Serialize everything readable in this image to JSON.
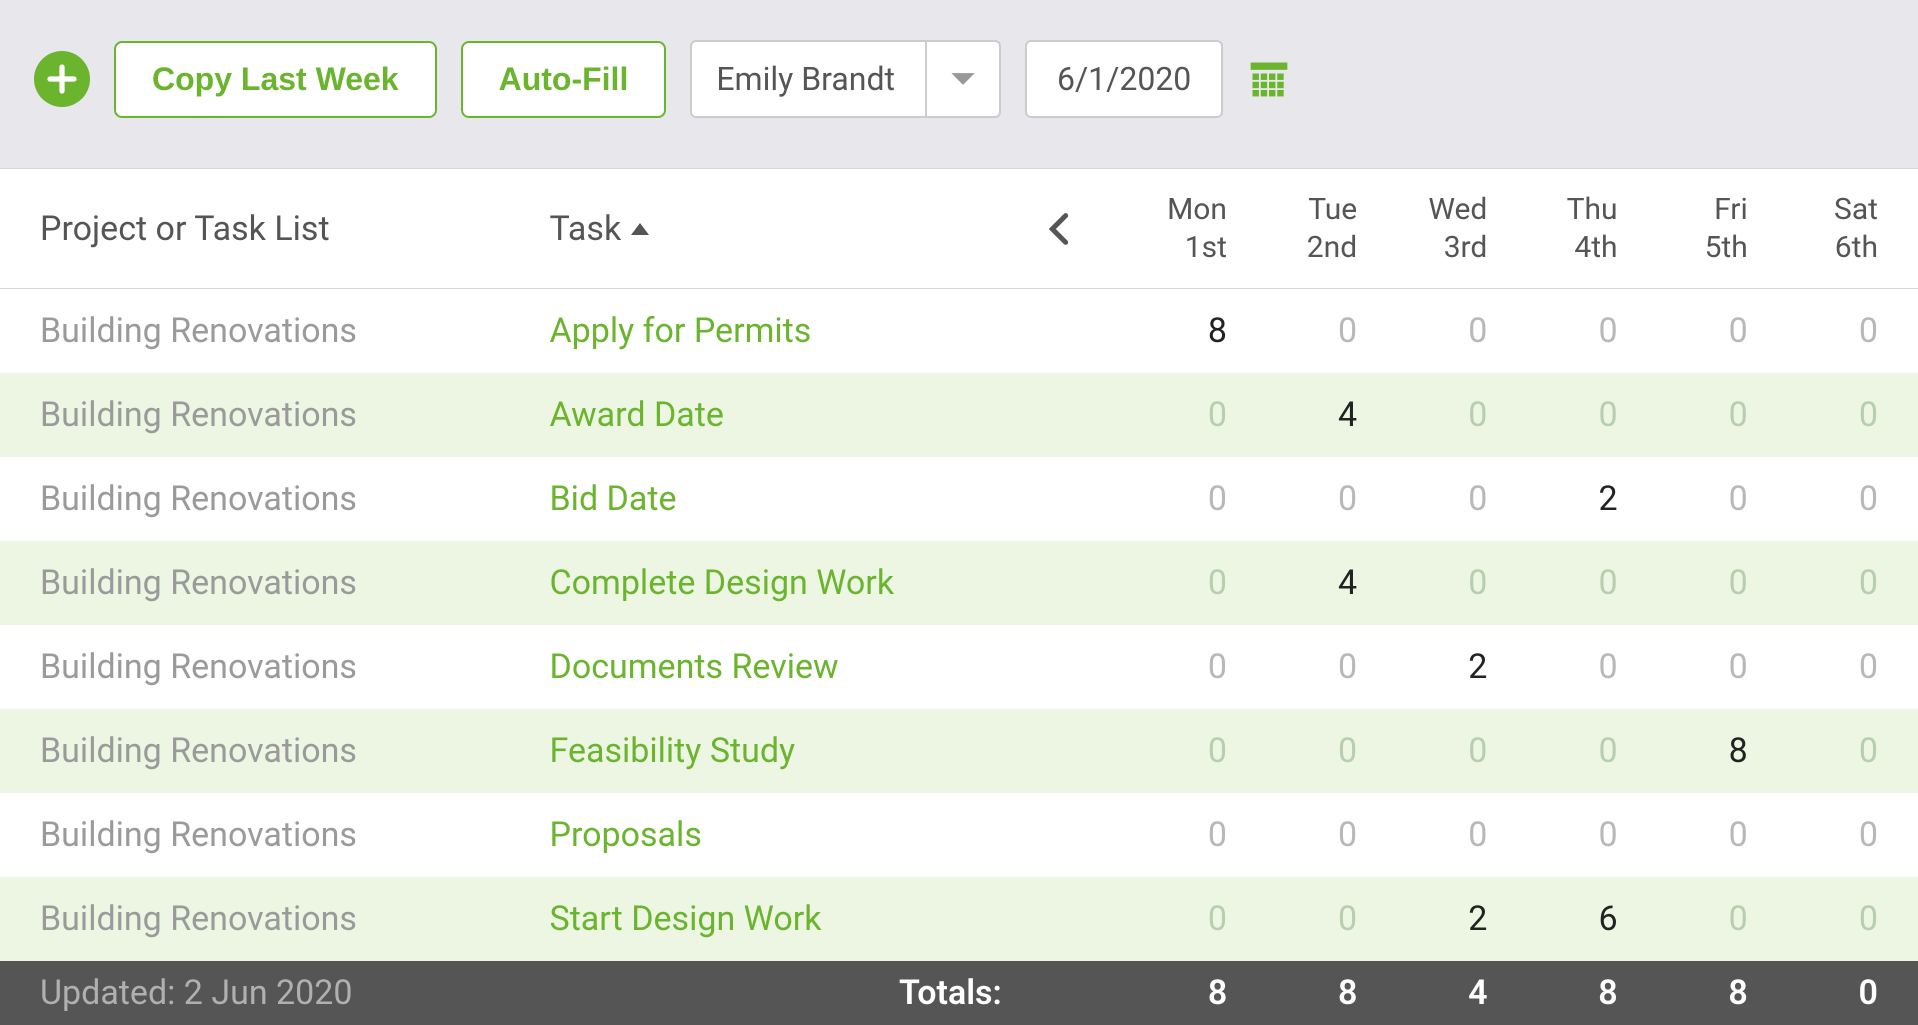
{
  "toolbar": {
    "copy_last_week_label": "Copy Last Week",
    "auto_fill_label": "Auto-Fill",
    "user_select_value": "Emily Brandt",
    "date_value": "6/1/2020"
  },
  "columns": {
    "project": "Project or Task List",
    "task": "Task"
  },
  "days": [
    {
      "name": "Mon",
      "num": "1st"
    },
    {
      "name": "Tue",
      "num": "2nd"
    },
    {
      "name": "Wed",
      "num": "3rd"
    },
    {
      "name": "Thu",
      "num": "4th"
    },
    {
      "name": "Fri",
      "num": "5th"
    },
    {
      "name": "Sat",
      "num": "6th"
    }
  ],
  "rows": [
    {
      "project": "Building Renovations",
      "task": "Apply for Permits",
      "hours": [
        "8",
        "0",
        "0",
        "0",
        "0",
        "0"
      ]
    },
    {
      "project": "Building Renovations",
      "task": "Award Date",
      "hours": [
        "0",
        "4",
        "0",
        "0",
        "0",
        "0"
      ]
    },
    {
      "project": "Building Renovations",
      "task": "Bid Date",
      "hours": [
        "0",
        "0",
        "0",
        "2",
        "0",
        "0"
      ]
    },
    {
      "project": "Building Renovations",
      "task": "Complete Design Work",
      "hours": [
        "0",
        "4",
        "0",
        "0",
        "0",
        "0"
      ]
    },
    {
      "project": "Building Renovations",
      "task": "Documents Review",
      "hours": [
        "0",
        "0",
        "2",
        "0",
        "0",
        "0"
      ]
    },
    {
      "project": "Building Renovations",
      "task": "Feasibility Study",
      "hours": [
        "0",
        "0",
        "0",
        "0",
        "8",
        "0"
      ]
    },
    {
      "project": "Building Renovations",
      "task": "Proposals",
      "hours": [
        "0",
        "0",
        "0",
        "0",
        "0",
        "0"
      ]
    },
    {
      "project": "Building Renovations",
      "task": "Start Design Work",
      "hours": [
        "0",
        "0",
        "2",
        "6",
        "0",
        "0"
      ]
    }
  ],
  "footer": {
    "updated_label": "Updated: 2 Jun 2020",
    "totals_label": "Totals:",
    "totals": [
      "8",
      "8",
      "4",
      "8",
      "8",
      "0"
    ]
  }
}
